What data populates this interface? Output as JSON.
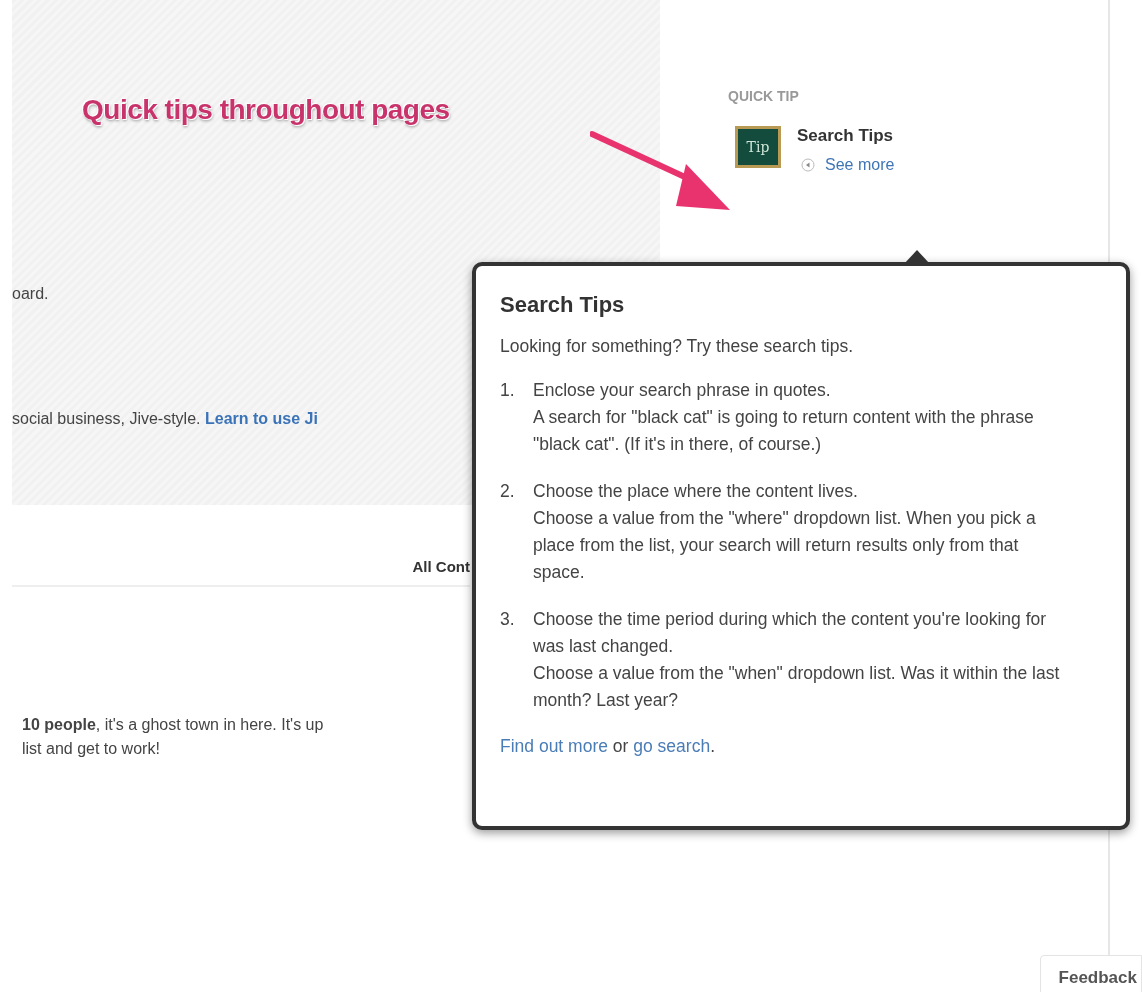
{
  "annotation": {
    "text": "Quick tips throughout pages"
  },
  "banner": {
    "line_1": "oard.",
    "line_2": "social business, Jive-style.",
    "link": "Learn to use Ji"
  },
  "content_tab": {
    "label": "All Cont"
  },
  "empty_message": {
    "line_1": "**10 people**, it's a ghost town in here. It's up",
    "line_2": "list and get to work!"
  },
  "quick_tip": {
    "heading": "QUICK TIP",
    "icon_text": "Tip",
    "title": "Search Tips",
    "link": "See more"
  },
  "popover": {
    "title": "Search Tips",
    "intro": "Looking for something? Try these search tips.",
    "tips": [
      {
        "number": "1.",
        "heading": "Enclose your search phrase in quotes.",
        "detail": "A search for \"black cat\" is going to return content with the phrase \"black cat\". (If it's in there, of course.)"
      },
      {
        "number": "2.",
        "heading": "Choose the place where the content lives.",
        "detail": "Choose a value from the \"where\" dropdown list. When you pick a place from the list, your search will return results only from that space."
      },
      {
        "number": "3.",
        "heading": "Choose the time period during which the content you're looking for was last changed.",
        "detail": "Choose a value from the \"when\" dropdown list. Was it within the last month? Last year?"
      }
    ],
    "footer": {
      "link_1": "Find out more",
      "joiner": "or",
      "link_2": "go search",
      "end": "."
    }
  },
  "feedback": {
    "label": "Feedback"
  }
}
